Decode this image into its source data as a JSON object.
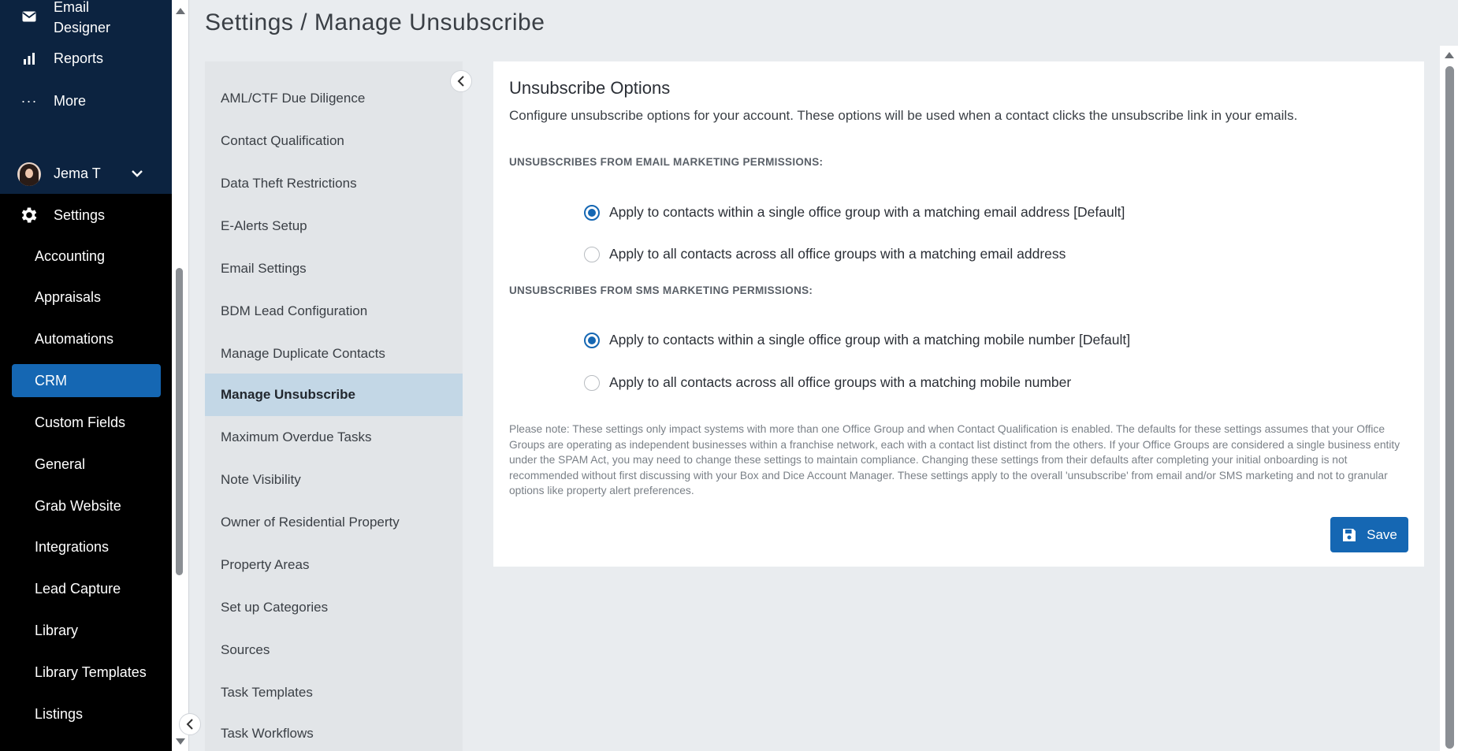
{
  "sidebar": {
    "top_items": [
      {
        "label": "Email\nDesigner",
        "icon": "envelope-icon"
      },
      {
        "label": "Reports",
        "icon": "bar-chart-icon"
      },
      {
        "label": "More",
        "icon": "ellipsis-icon"
      }
    ],
    "user": {
      "name": "Jema T"
    },
    "settings_label": "Settings",
    "items": [
      {
        "label": "Accounting"
      },
      {
        "label": "Appraisals"
      },
      {
        "label": "Automations"
      },
      {
        "label": "CRM",
        "active": true
      },
      {
        "label": "Custom Fields"
      },
      {
        "label": "General"
      },
      {
        "label": "Grab Website"
      },
      {
        "label": "Integrations"
      },
      {
        "label": "Lead Capture"
      },
      {
        "label": "Library"
      },
      {
        "label": "Library Templates"
      },
      {
        "label": "Listings"
      }
    ]
  },
  "header": {
    "title": "Settings / Manage Unsubscribe"
  },
  "settings_menu": {
    "items": [
      {
        "label": "AML/CTF Due Diligence"
      },
      {
        "label": "Contact Qualification"
      },
      {
        "label": "Data Theft Restrictions"
      },
      {
        "label": "E-Alerts Setup"
      },
      {
        "label": "Email Settings"
      },
      {
        "label": "BDM Lead Configuration"
      },
      {
        "label": "Manage Duplicate Contacts"
      },
      {
        "label": "Manage Unsubscribe",
        "active": true
      },
      {
        "label": "Maximum Overdue Tasks"
      },
      {
        "label": "Note Visibility"
      },
      {
        "label": "Owner of Residential Property"
      },
      {
        "label": "Property Areas"
      },
      {
        "label": "Set up Categories"
      },
      {
        "label": "Sources"
      },
      {
        "label": "Task Templates"
      },
      {
        "label": "Task Workflows"
      }
    ]
  },
  "panel": {
    "title": "Unsubscribe Options",
    "description": "Configure unsubscribe options for your account. These options will be used when a contact clicks the unsubscribe link in your emails.",
    "email_section": {
      "heading": "UNSUBSCRIBES FROM EMAIL MARKETING PERMISSIONS:",
      "options": [
        {
          "label": "Apply to contacts within a single office group with a matching email address [Default]",
          "checked": true
        },
        {
          "label": "Apply to all contacts across all office groups with a matching email address",
          "checked": false
        }
      ]
    },
    "sms_section": {
      "heading": "UNSUBSCRIBES FROM SMS MARKETING PERMISSIONS:",
      "options": [
        {
          "label": "Apply to contacts within a single office group with a matching mobile number [Default]",
          "checked": true
        },
        {
          "label": "Apply to all contacts across all office groups with a matching mobile number",
          "checked": false
        }
      ]
    },
    "note": "Please note: These settings only impact systems with more than one Office Group and when Contact Qualification is enabled. The defaults for these settings assumes that your Office Groups are operating as independent businesses within a franchise network, each with a contact list distinct from the others. If your Office Groups are considered a single business entity under the SPAM Act, you may need to change these settings to maintain compliance. Changing these settings from their defaults after completing your initial onboarding is not recommended without first discussing with your Box and Dice Account Manager. These settings apply to the overall 'unsubscribe' from email and/or SMS marketing and not to granular options like property alert preferences.",
    "save_label": "Save"
  },
  "colors": {
    "accent": "#1567b3",
    "sidebar_top": "#0c2340",
    "active_menu": "#c3d7e6"
  }
}
